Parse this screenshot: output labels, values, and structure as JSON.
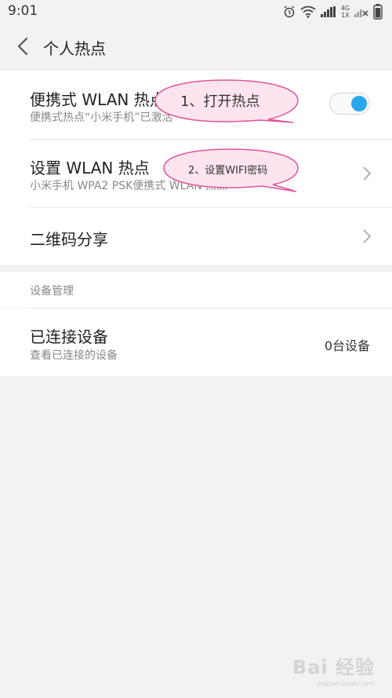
{
  "status_bar": {
    "time": "9:01",
    "network_type": "4G",
    "sim_label": "1X",
    "icons": [
      "alarm-icon",
      "wifi-icon",
      "signal-icon",
      "no-signal-icon",
      "battery-icon"
    ]
  },
  "header": {
    "title": "个人热点",
    "back_icon": "chevron-left-icon"
  },
  "rows": {
    "portable_hotspot": {
      "title": "便携式 WLAN 热点",
      "subtitle": "便携式热点“小米手机”已激活",
      "toggle_on": true
    },
    "setup_hotspot": {
      "title": "设置 WLAN 热点",
      "subtitle": "小米手机 WPA2 PSK便携式 WLAN 热点"
    },
    "qr_share": {
      "title": "二维码分享"
    },
    "device_section_label": "设备管理",
    "connected_devices": {
      "title": "已连接设备",
      "subtitle": "查看已连接的设备",
      "count": "0台设备"
    }
  },
  "annotations": {
    "bubble1": "1、打开热点",
    "bubble2": "2、设置WIFI密码"
  },
  "watermark": {
    "text": "Bai 经验",
    "url": "jingyan.baidu.com"
  },
  "colors": {
    "background": "#f2f2f2",
    "card": "#ffffff",
    "accent_toggle": "#2aa7ef",
    "bubble_fill": "#fde4ef",
    "bubble_stroke": "#e0559a"
  }
}
